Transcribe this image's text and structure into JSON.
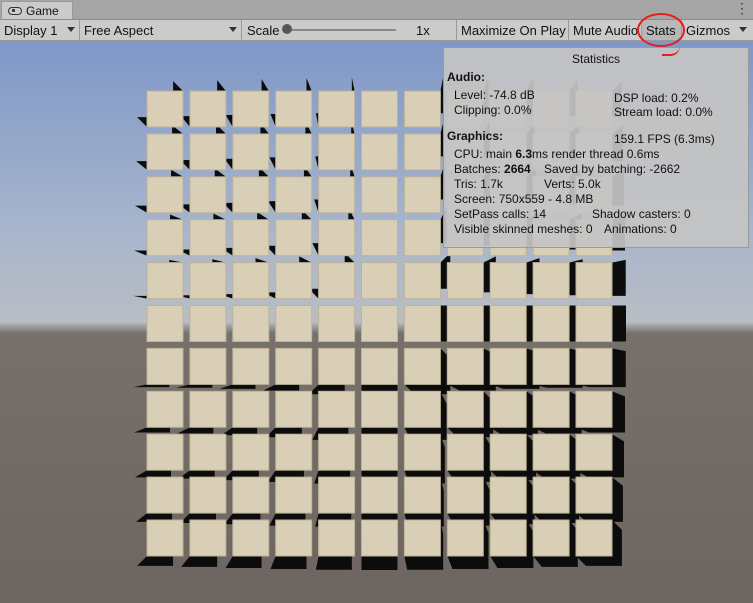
{
  "tab": {
    "label": "Game",
    "icon": "gamepad-icon"
  },
  "toolbar": {
    "display": "Display 1",
    "aspect": "Free Aspect",
    "scale_label": "Scale",
    "scale_value": "1x",
    "maximize": "Maximize On Play",
    "mute": "Mute Audio",
    "stats": "Stats",
    "gizmos": "Gizmos"
  },
  "stats": {
    "title": "Statistics",
    "audio_header": "Audio:",
    "level": "Level: -74.8 dB",
    "clipping": "Clipping: 0.0%",
    "dsp": "DSP load: 0.2%",
    "stream": "Stream load: 0.0%",
    "graphics_header": "Graphics:",
    "fps": "159.1 FPS (6.3ms)",
    "cpu_prefix": "CPU: main ",
    "cpu_main": "6.3",
    "cpu_suffix": "ms  render thread 0.6ms",
    "batches_prefix": "Batches: ",
    "batches": "2664",
    "saved": "Saved by batching: -2662",
    "tris": "Tris: 1.7k",
    "verts": "Verts: 5.0k",
    "screen": "Screen: 750x559 - 4.8 MB",
    "setpass": "SetPass calls: 14",
    "shadow": "Shadow casters: 0",
    "skinned": "Visible skinned meshes: 0",
    "animations": "Animations: 0"
  },
  "scene": {
    "grid_cols": 11,
    "grid_rows": 11,
    "cube_color": "#d8cfb6",
    "shadow_color": "#0c0c0c"
  }
}
